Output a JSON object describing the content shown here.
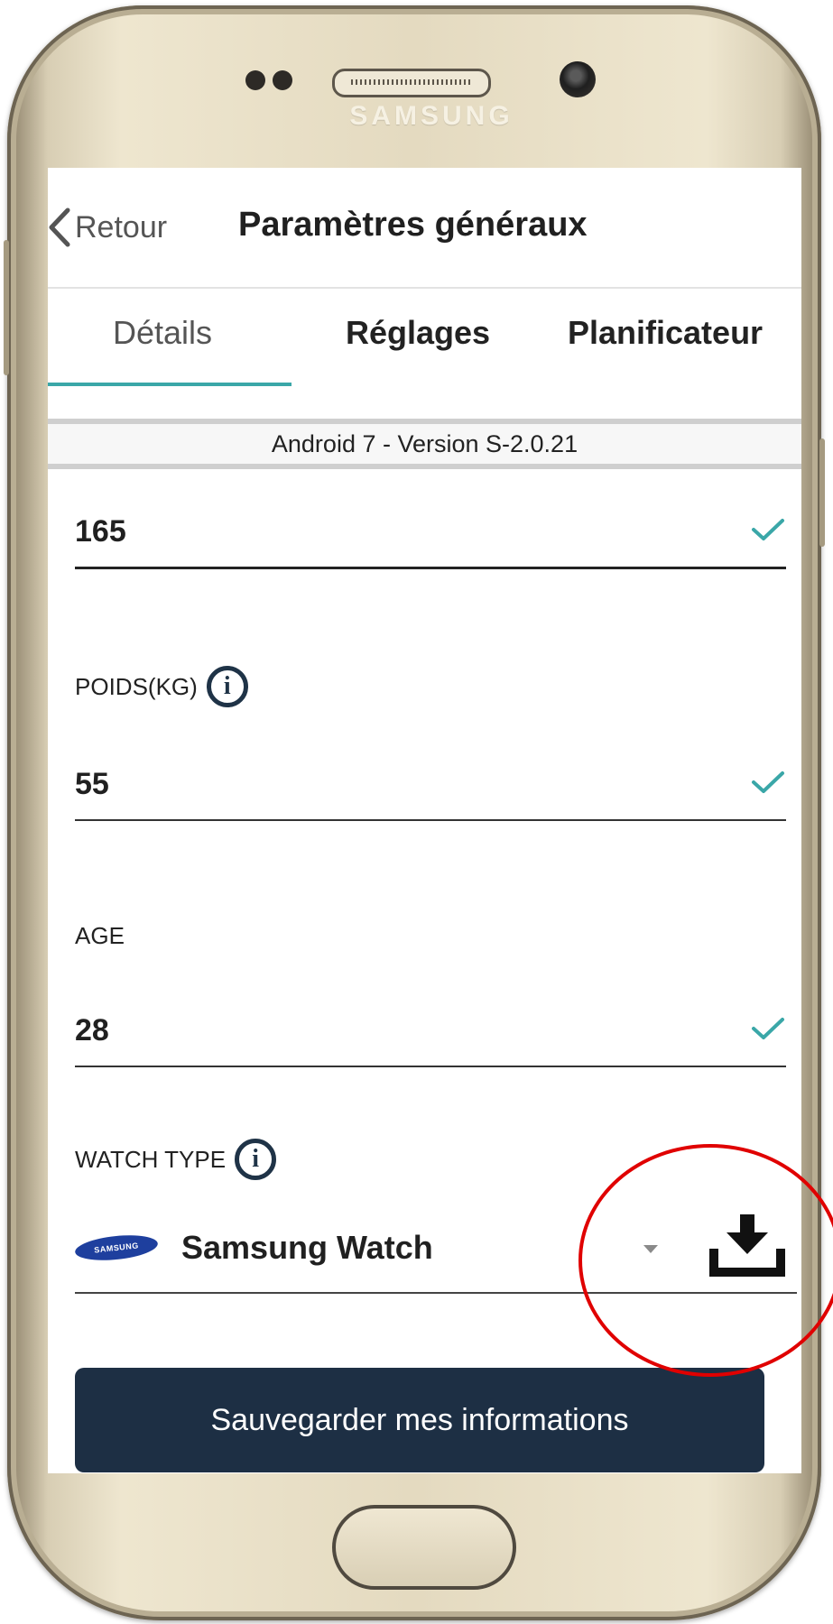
{
  "device": {
    "brand": "SAMSUNG"
  },
  "header": {
    "back_label": "Retour",
    "title": "Paramètres généraux"
  },
  "tabs": [
    {
      "label": "Détails",
      "active": true
    },
    {
      "label": "Réglages",
      "active": false
    },
    {
      "label": "Planificateur",
      "active": false
    }
  ],
  "version": "Android 7 - Version S-2.0.21",
  "fields": {
    "height": {
      "value": "165",
      "valid": true
    },
    "weight": {
      "label": "POIDS(KG)",
      "value": "55",
      "valid": true
    },
    "age": {
      "label": "AGE",
      "value": "28",
      "valid": true
    },
    "watch_type": {
      "label": "WATCH TYPE",
      "logo_text": "SAMSUNG",
      "selected": "Samsung Watch"
    }
  },
  "save_button": "Sauvegarder mes informations",
  "colors": {
    "accent": "#3aa7a8",
    "check": "#3aa7a8",
    "button": "#1d2f44",
    "highlight": "#e00000"
  },
  "icons": [
    "chevron-left-icon",
    "check-icon",
    "info-icon",
    "dropdown-arrow-icon",
    "download-icon",
    "samsung-logo"
  ]
}
